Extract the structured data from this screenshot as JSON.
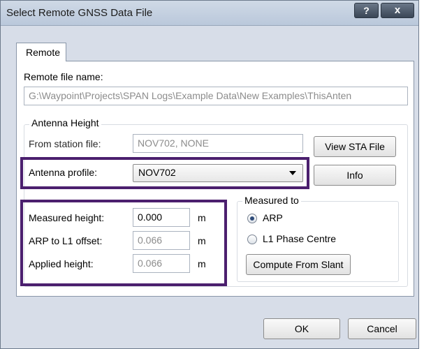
{
  "window": {
    "title": "Select Remote GNSS Data File",
    "help_label": "?",
    "close_label": "x"
  },
  "tabs": [
    {
      "label": "Remote",
      "active": true
    }
  ],
  "remote": {
    "file_name_label": "Remote file name:",
    "file_name_value": "G:\\Waypoint\\Projects\\SPAN Logs\\Example Data\\New Examples\\ThisAnten"
  },
  "antenna": {
    "group_label": "Antenna Height",
    "from_station_label": "From station file:",
    "from_station_value": "NOV702, NONE",
    "view_sta_button": "View STA File",
    "profile_label": "Antenna profile:",
    "profile_value": "NOV702",
    "info_button": "Info",
    "measured_height_label": "Measured height:",
    "measured_height_value": "0.000",
    "arp_offset_label": "ARP to L1 offset:",
    "arp_offset_value": "0.066",
    "applied_height_label": "Applied height:",
    "applied_height_value": "0.066",
    "unit": "m"
  },
  "measured_to": {
    "group_label": "Measured to",
    "options": [
      {
        "label": "ARP",
        "selected": true
      },
      {
        "label": "L1 Phase Centre",
        "selected": false
      }
    ],
    "compute_button": "Compute From Slant"
  },
  "footer": {
    "ok_button": "OK",
    "cancel_button": "Cancel"
  },
  "colors": {
    "highlight": "#4b1f6e",
    "window_frame": "#d7dde8",
    "panel": "#ffffff"
  }
}
